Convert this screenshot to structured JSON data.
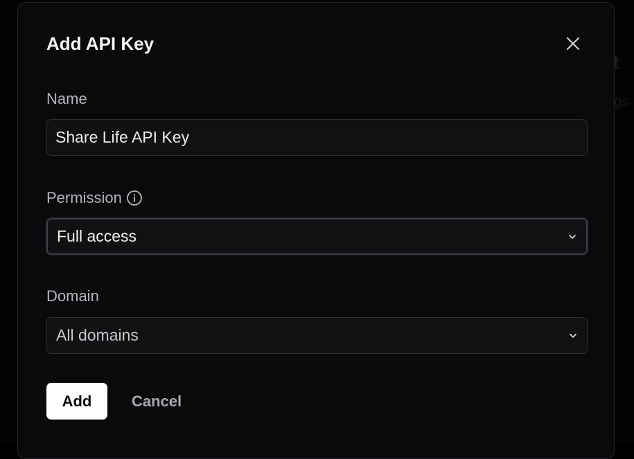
{
  "background": {
    "partial_title": "t",
    "partial_subtitle": "gs"
  },
  "dialog": {
    "title": "Add API Key",
    "close_icon": "close-icon",
    "name_field": {
      "label": "Name",
      "value": "Share Life API Key"
    },
    "permission_field": {
      "label": "Permission",
      "info_icon": "info-icon",
      "selected": "Full access"
    },
    "domain_field": {
      "label": "Domain",
      "selected": "All domains"
    },
    "actions": {
      "add_label": "Add",
      "cancel_label": "Cancel"
    }
  },
  "colors": {
    "dialog_background": "#0a0a0c",
    "primary_button": "#ffffff",
    "focus_ring": "#3c3d45"
  }
}
